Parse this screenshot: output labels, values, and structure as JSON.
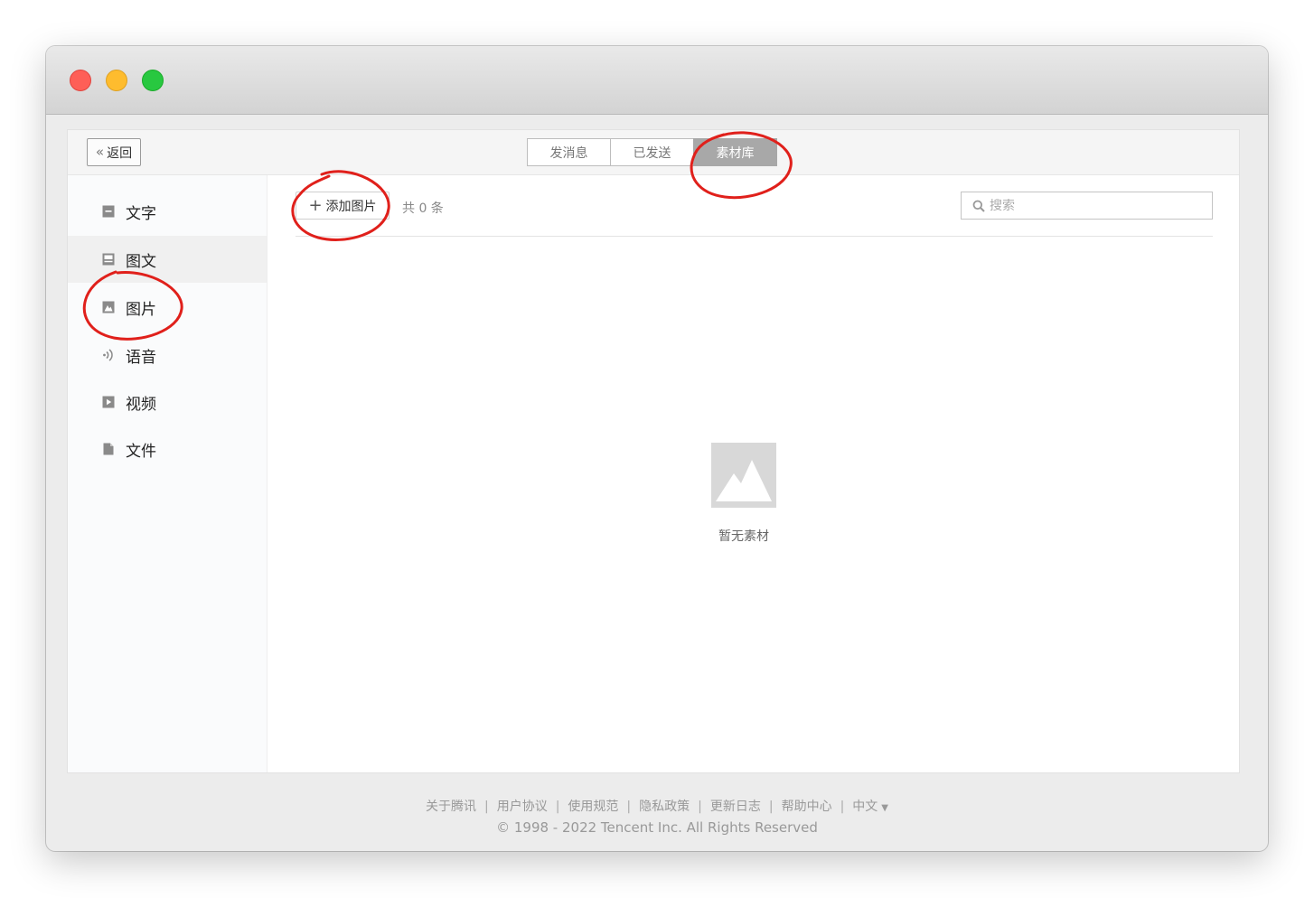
{
  "toolbar": {
    "back_label": "返回"
  },
  "tabs": [
    {
      "label": "发消息",
      "active": false
    },
    {
      "label": "已发送",
      "active": false
    },
    {
      "label": "素材库",
      "active": true
    }
  ],
  "sidebar": {
    "items": [
      {
        "label": "文字",
        "icon": "text-icon"
      },
      {
        "label": "图文",
        "icon": "article-icon"
      },
      {
        "label": "图片",
        "icon": "image-icon"
      },
      {
        "label": "语音",
        "icon": "voice-icon"
      },
      {
        "label": "视频",
        "icon": "video-icon"
      },
      {
        "label": "文件",
        "icon": "file-icon"
      }
    ]
  },
  "main": {
    "add_button_label": "添加图片",
    "count_text": "共 0 条",
    "search_placeholder": "搜索",
    "empty_text": "暂无素材"
  },
  "footer": {
    "links": [
      "关于腾讯",
      "用户协议",
      "使用规范",
      "隐私政策",
      "更新日志",
      "帮助中心",
      "中文"
    ],
    "copyright": "© 1998 - 2022 Tencent Inc. All Rights Reserved"
  },
  "colors": {
    "active_tab": "#a8a8a8",
    "annotation": "#e0201b",
    "close": "#fe5f57",
    "minimize": "#febc2e",
    "zoom": "#28c840"
  }
}
